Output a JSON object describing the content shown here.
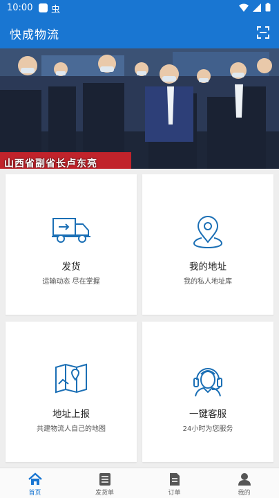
{
  "status_bar": {
    "time": "10:00",
    "bug_glyph": "虫"
  },
  "app_bar": {
    "title": "快成物流",
    "scan_icon": "scan-icon"
  },
  "banner": {
    "caption": "山西省副省长卢东亮"
  },
  "cards": [
    {
      "title": "发货",
      "subtitle": "运输动态  尽在掌握",
      "icon": "truck-icon"
    },
    {
      "title": "我的地址",
      "subtitle": "我的私人地址库",
      "icon": "location-pin-icon"
    },
    {
      "title": "地址上报",
      "subtitle": "共建物流人自己的地图",
      "icon": "map-icon"
    },
    {
      "title": "一键客服",
      "subtitle": "24小时为您服务",
      "icon": "customer-service-icon"
    }
  ],
  "tabs": [
    {
      "label": "首页",
      "icon": "home-icon",
      "active": true
    },
    {
      "label": "发货单",
      "icon": "list-icon",
      "active": false
    },
    {
      "label": "订单",
      "icon": "document-icon",
      "active": false
    },
    {
      "label": "我的",
      "icon": "user-icon",
      "active": false
    }
  ],
  "colors": {
    "primary": "#1976d2",
    "icon_blue": "#1b6fb5",
    "background": "#eeeeee"
  }
}
